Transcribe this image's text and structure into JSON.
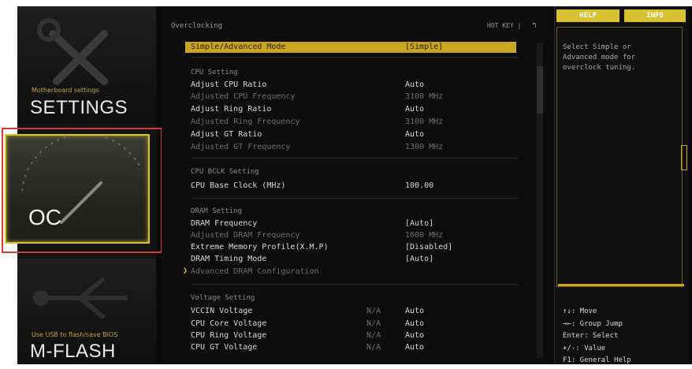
{
  "nav": {
    "settings_sub": "Motherboard settings",
    "settings_title": "SETTINGS",
    "oc_title": "OC",
    "mflash_sub": "Use USB to flash/save BIOS",
    "mflash_title": "M-FLASH"
  },
  "header": {
    "breadcrumb": "Overclocking",
    "hotkey": "HOT KEY |",
    "back_glyph": "↰"
  },
  "rows": [
    {
      "label": "Simple/Advanced Mode",
      "value": "[Simple]",
      "type": "sel"
    },
    {
      "label": "CPU Setting",
      "type": "hdr"
    },
    {
      "label": "Adjust CPU Ratio",
      "value": "Auto"
    },
    {
      "label": "Adjusted CPU Frequency",
      "value": "3100 MHz",
      "type": "dim"
    },
    {
      "label": "Adjust Ring Ratio",
      "value": "Auto"
    },
    {
      "label": "Adjusted Ring Frequency",
      "value": "3100 MHz",
      "type": "dim"
    },
    {
      "label": "Adjust GT Ratio",
      "value": "Auto"
    },
    {
      "label": "Adjusted GT Frequency",
      "value": "1300 MHz",
      "type": "dim"
    },
    {
      "label": "CPU BCLK Setting",
      "type": "hdr"
    },
    {
      "label": "CPU Base Clock (MHz)",
      "value": "100.00"
    },
    {
      "label": "DRAM Setting",
      "type": "hdr"
    },
    {
      "label": "DRAM Frequency",
      "value": "[Auto]"
    },
    {
      "label": "Adjusted DRAM Frequency",
      "value": "1600 MHz",
      "type": "dim"
    },
    {
      "label": "Extreme Memory Profile(X.M.P)",
      "value": "[Disabled]"
    },
    {
      "label": "DRAM Timing Mode",
      "value": "[Auto]"
    },
    {
      "label": "Advanced DRAM Configuration",
      "type": "sub"
    },
    {
      "label": "Voltage Setting",
      "type": "hdr"
    },
    {
      "label": "VCCIN Voltage",
      "na": "N/A",
      "value": "Auto"
    },
    {
      "label": "CPU Core Voltage",
      "na": "N/A",
      "value": "Auto"
    },
    {
      "label": "CPU Ring Voltage",
      "na": "N/A",
      "value": "Auto"
    },
    {
      "label": "CPU GT Voltage",
      "na": "N/A",
      "value": "Auto"
    }
  ],
  "help": {
    "tab_help": "HELP",
    "tab_info": "INFO",
    "text": "Select Simple or\nAdvanced mode for\noverclock tuning.",
    "keys": "↑↓: Move\n→←: Group Jump\nEnter: Select\n+/-: Value\nF1: General Help"
  },
  "colors": {
    "accent": "#d9c232",
    "highlight": "#c8a61f",
    "annotation": "#d23a3a"
  }
}
